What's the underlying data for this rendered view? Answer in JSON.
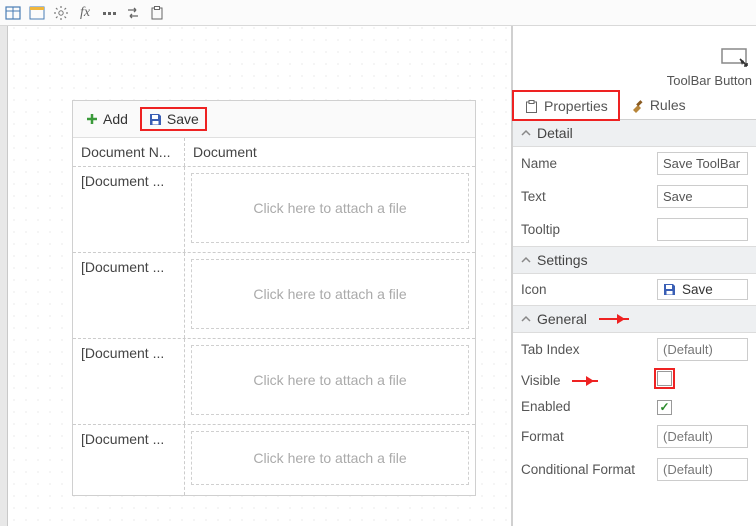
{
  "toolbar_icons": [
    "table",
    "form",
    "gear",
    "fx",
    "ellipsis",
    "swap",
    "clipboard"
  ],
  "design": {
    "add_label": "Add",
    "save_label": "Save",
    "columns": {
      "col1": "Document N...",
      "col2": "Document"
    },
    "row_label": "[Document ...",
    "attach_placeholder": "Click here to attach a file"
  },
  "right": {
    "header_title": "ToolBar Button",
    "tabs": {
      "properties": "Properties",
      "rules": "Rules"
    },
    "sections": {
      "detail": "Detail",
      "settings": "Settings",
      "general": "General"
    },
    "detail": {
      "name_label": "Name",
      "name_value": "Save ToolBar",
      "text_label": "Text",
      "text_value": "Save",
      "tooltip_label": "Tooltip",
      "tooltip_value": ""
    },
    "settings": {
      "icon_label": "Icon",
      "icon_value": "Save"
    },
    "general": {
      "tab_index_label": "Tab Index",
      "tab_index_value": "(Default)",
      "visible_label": "Visible",
      "enabled_label": "Enabled",
      "format_label": "Format",
      "format_value": "(Default)",
      "cond_format_label": "Conditional Format",
      "cond_format_value": "(Default)"
    }
  }
}
